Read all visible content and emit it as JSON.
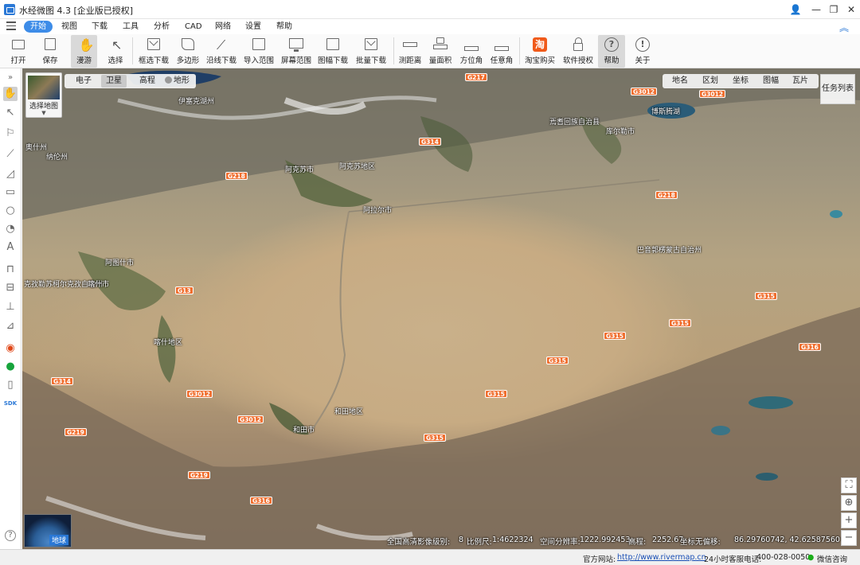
{
  "window": {
    "title": "水经微图 4.3 [企业版已授权]",
    "controls": [
      "user-icon",
      "minimize-icon",
      "restore-icon",
      "close-icon"
    ]
  },
  "menu": {
    "items": [
      {
        "label": "开始",
        "active": true
      },
      {
        "label": "视图"
      },
      {
        "label": "下载"
      },
      {
        "label": "工具"
      },
      {
        "label": "分析"
      },
      {
        "label": "CAD"
      },
      {
        "label": "网络"
      },
      {
        "label": "设置"
      },
      {
        "label": "帮助"
      }
    ]
  },
  "ribbon": {
    "tools": [
      {
        "label": "打开",
        "icon": "folder-icon"
      },
      {
        "label": "保存",
        "icon": "save-icon"
      },
      {
        "label": "漫游",
        "icon": "hand-icon",
        "pressed": true
      },
      {
        "label": "选择",
        "icon": "cursor-icon"
      },
      {
        "label": "框选下载",
        "icon": "box-download-icon"
      },
      {
        "label": "多边形",
        "icon": "polygon-download-icon"
      },
      {
        "label": "沿线下载",
        "icon": "line-download-icon"
      },
      {
        "label": "导入范围",
        "icon": "import-range-icon"
      },
      {
        "label": "屏幕范围",
        "icon": "screen-range-icon"
      },
      {
        "label": "图幅下载",
        "icon": "sheet-download-icon"
      },
      {
        "label": "批量下载",
        "icon": "batch-download-icon"
      },
      {
        "label": "测距离",
        "icon": "ruler-icon"
      },
      {
        "label": "量面积",
        "icon": "area-icon"
      },
      {
        "label": "方位角",
        "icon": "azimuth-icon"
      },
      {
        "label": "任意角",
        "icon": "angle-icon"
      },
      {
        "label": "淘宝购买",
        "icon": "taobao-icon"
      },
      {
        "label": "软件授权",
        "icon": "lock-icon"
      },
      {
        "label": "帮助",
        "icon": "help-icon",
        "pressed": true
      },
      {
        "label": "关于",
        "icon": "info-icon"
      }
    ]
  },
  "map": {
    "select_map_label": "选择地图",
    "types": [
      {
        "label": "电子"
      },
      {
        "label": "卫星",
        "active": true
      },
      {
        "label": "高程"
      },
      {
        "label": "地形"
      }
    ],
    "overlays": [
      "地名",
      "区划",
      "坐标",
      "图幅",
      "瓦片"
    ],
    "task_list_label": "任务列表",
    "globe_label": "地球",
    "place_labels": [
      "伊塞克湖州",
      "阿克苏市",
      "阿克苏地区",
      "阿拉尔市",
      "阿图什市",
      "克孜勒苏柯尔克孜自治州",
      "喀什市",
      "喀什地区",
      "和田地区",
      "和田市",
      "巴音郭楞蒙古自治州",
      "博斯腾湖",
      "库尔勒市",
      "焉耆回族自治县",
      "纳伦州",
      "奥什州"
    ],
    "road_shields": [
      "G217",
      "G3012",
      "G314",
      "G218",
      "G218",
      "G3012",
      "G315",
      "G315",
      "G315",
      "G315",
      "G3012",
      "G315",
      "G219",
      "G219",
      "G314",
      "G316",
      "G316",
      "G3012",
      "G315",
      "G13"
    ]
  },
  "info": {
    "imagery": "全国高清影像",
    "level_label": "级别:",
    "level": "8",
    "scale_label": "比例尺:",
    "scale": "1:4622324",
    "resolution_label": "空间分辨率:",
    "resolution": "1222.992453",
    "elevation_label": "高程:",
    "elevation": "2252.67",
    "coord_label": "坐标无偏移:",
    "coord": "86.29760742, 42.62587560"
  },
  "status": {
    "website_label": "官方网站:",
    "website": "http://www.rivermap.cn",
    "hotline_label": "24小时客服电话:",
    "hotline": "400-028-0050",
    "wechat_label": "微信咨询"
  },
  "colors": {
    "accent": "#3d8ce8",
    "road_shield": "#f06e2e"
  }
}
